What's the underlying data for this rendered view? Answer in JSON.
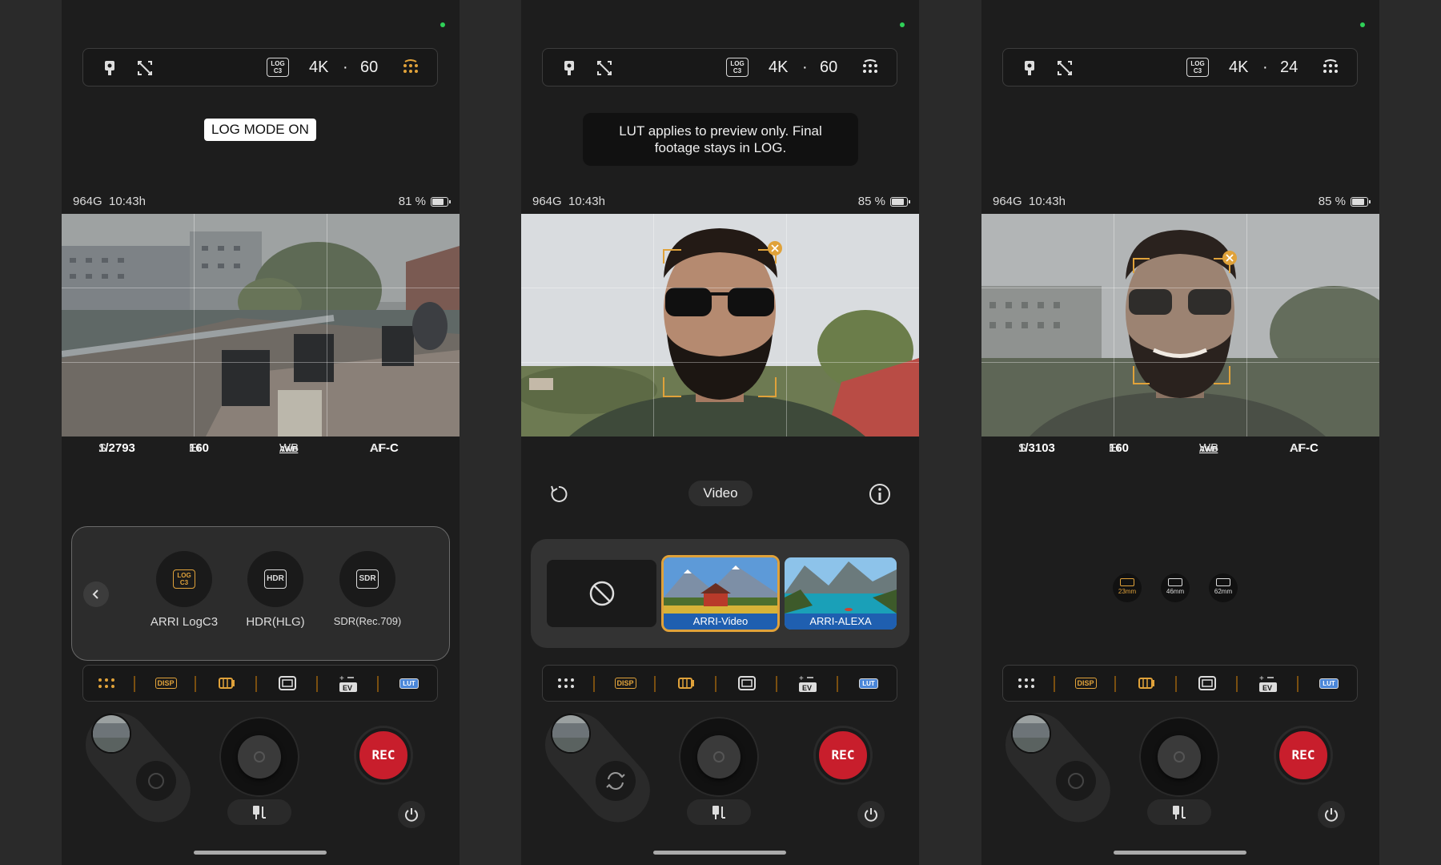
{
  "screens": [
    {
      "topbar": {
        "log_badge": "LOG\nC3",
        "resolution": "4K",
        "separator": "·",
        "fps": "60",
        "grid_icon_color": "#e0a23a"
      },
      "toast": "LOG MODE ON",
      "status": {
        "storage_time": "964G  10:43h",
        "battery": "81 %"
      },
      "params": {
        "s_label": "S",
        "s_value": "1/2793",
        "ei_label": "EI",
        "ei_value": "160",
        "wb_label": "WB",
        "wb_value": "AWB",
        "af_label": "AF",
        "af_value": "AF-C"
      },
      "modes": [
        {
          "badge": "LOG\nC3",
          "label": "ARRI LogC3"
        },
        {
          "badge": "HDR",
          "label": "HDR(HLG)"
        },
        {
          "badge": "SDR",
          "label": "SDR(Rec.709)"
        }
      ]
    },
    {
      "topbar": {
        "log_badge": "LOG\nC3",
        "resolution": "4K",
        "separator": "·",
        "fps": "60",
        "grid_icon_color": "#e8e8e8"
      },
      "toast": "LUT applies to preview only. Final footage stays in LOG.",
      "status": {
        "storage_time": "964G  10:43h",
        "battery": "85 %"
      },
      "mode_pill": "Video",
      "luts": [
        {
          "name": "ARRI-Video",
          "selected": true
        },
        {
          "name": "ARRI-ALEXA",
          "selected": false
        }
      ]
    },
    {
      "topbar": {
        "log_badge": "LOG\nC3",
        "resolution": "4K",
        "separator": "·",
        "fps": "24",
        "grid_icon_color": "#e8e8e8"
      },
      "status": {
        "storage_time": "964G  10:43h",
        "battery": "85 %"
      },
      "params": {
        "s_label": "S",
        "s_value": "1/3103",
        "ei_label": "EI",
        "ei_value": "160",
        "wb_label": "WB",
        "wb_value": "AWB",
        "af_label": "AF",
        "af_value": "AF-C"
      },
      "lenses": [
        {
          "label": "23mm",
          "active": true
        },
        {
          "label": "46mm",
          "active": false
        },
        {
          "label": "62mm",
          "active": false
        }
      ]
    }
  ],
  "toolbar": {
    "disp": "DISP",
    "ev": "EV",
    "lut": "LUT"
  },
  "rec_label": "REC",
  "accent": "#e0a23a",
  "rec_color": "#c81e2c"
}
